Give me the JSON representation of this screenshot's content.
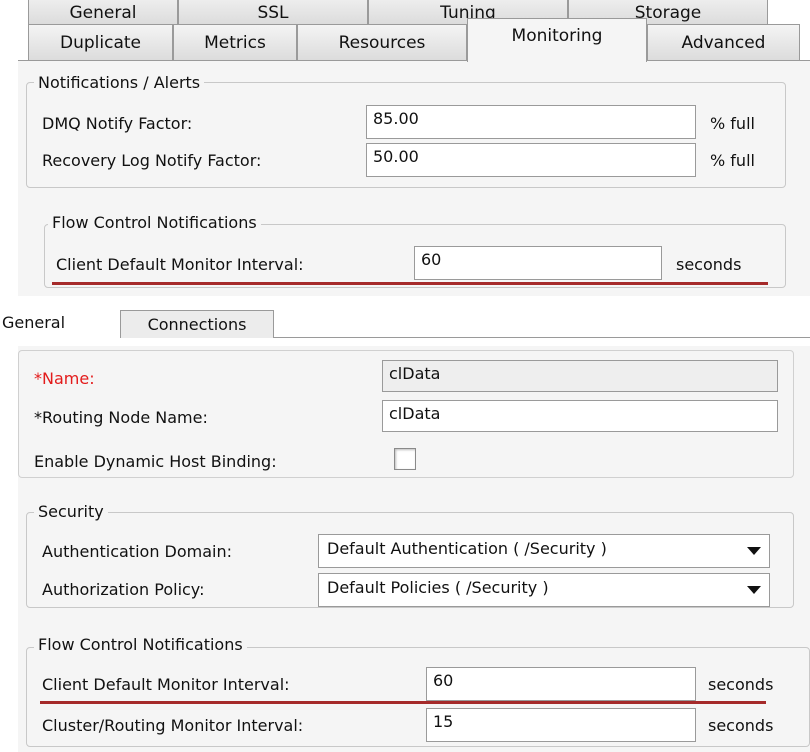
{
  "top_tabs": {
    "row1": [
      "General",
      "SSL",
      "Tuning",
      "Storage"
    ],
    "row2": [
      "Duplicate",
      "Metrics",
      "Resources",
      "Monitoring",
      "Advanced"
    ],
    "active": "Monitoring"
  },
  "notifications": {
    "title": "Notifications / Alerts",
    "dmq_label": "DMQ Notify Factor:",
    "dmq_value": "85.00",
    "dmq_unit": "% full",
    "recovery_label": "Recovery Log Notify Factor:",
    "recovery_value": "50.00",
    "recovery_unit": "% full"
  },
  "flow_top": {
    "title": "Flow Control Notifications",
    "client_label": "Client Default Monitor Interval:",
    "client_value": "60",
    "client_unit": "seconds"
  },
  "lower_tabs": [
    "General",
    "Connections"
  ],
  "general": {
    "name_label": "*Name:",
    "name_value": "clData",
    "routing_label": "*Routing Node Name:",
    "routing_value": "clData",
    "dynamic_label": "Enable Dynamic Host Binding:",
    "dynamic_checked": false
  },
  "security": {
    "title": "Security",
    "auth_domain_label": "Authentication Domain:",
    "auth_domain_value": "Default Authentication ( /Security )",
    "auth_policy_label": "Authorization Policy:",
    "auth_policy_value": "Default Policies ( /Security )"
  },
  "flow_bottom": {
    "title": "Flow Control Notifications",
    "client_label": "Client Default Monitor Interval:",
    "client_value": "60",
    "client_unit": "seconds",
    "cluster_label": "Cluster/Routing Monitor Interval:",
    "cluster_value": "15",
    "cluster_unit": "seconds"
  },
  "colors": {
    "required": "#e31b1b",
    "underline": "#a52a2a",
    "panel": "#f5f5f5"
  }
}
